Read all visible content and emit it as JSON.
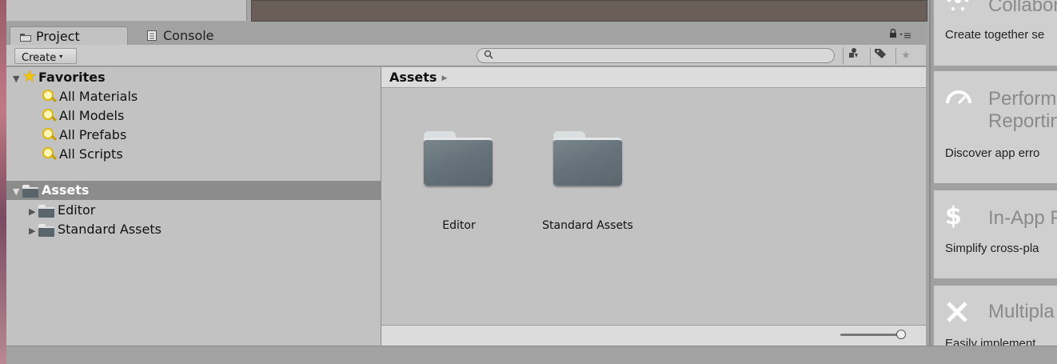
{
  "tabs": {
    "project": "Project",
    "console": "Console"
  },
  "toolbar": {
    "create_label": "Create",
    "create_arrow": "▾",
    "search_placeholder": ""
  },
  "tree": {
    "favorites": {
      "label": "Favorites",
      "items": [
        "All Materials",
        "All Models",
        "All Prefabs",
        "All Scripts"
      ]
    },
    "assets": {
      "label": "Assets",
      "children": [
        "Editor",
        "Standard Assets"
      ]
    }
  },
  "main": {
    "breadcrumb": "Assets",
    "folders": [
      "Editor",
      "Standard Assets"
    ]
  },
  "services": [
    {
      "icon": "collaborate-icon",
      "title": "Collabor",
      "desc": "Create together se"
    },
    {
      "icon": "performance-icon",
      "title": "Perform",
      "title2": "Reportin",
      "desc": "Discover app erro"
    },
    {
      "icon": "dollar-icon",
      "title": "In-App P",
      "desc": "Simplify cross-pla"
    },
    {
      "icon": "multiplayer-icon",
      "title": "Multipla",
      "desc": "Easily implement"
    }
  ],
  "colors": {
    "scene_bg": "#695f58",
    "panel_bg": "#c2c2c2",
    "selection": "#8c8c8c",
    "folder": "#5a666d"
  }
}
